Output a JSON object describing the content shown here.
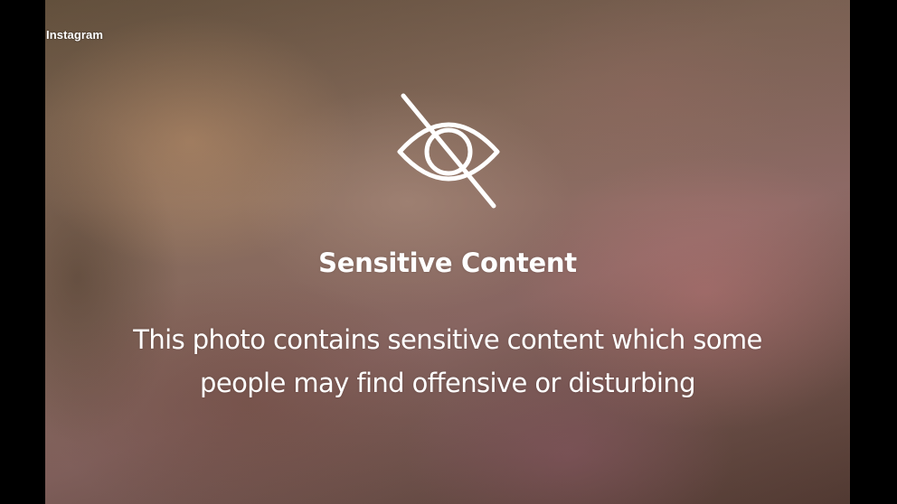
{
  "watermark": {
    "label": "Instagram"
  },
  "overlay": {
    "icon": "eye-slash-icon",
    "title": "Sensitive Content",
    "message": "This photo contains sensitive content which some people may find offensive or disturbing"
  },
  "colors": {
    "overlay_text": "#ffffff",
    "letterbox": "#000000"
  }
}
